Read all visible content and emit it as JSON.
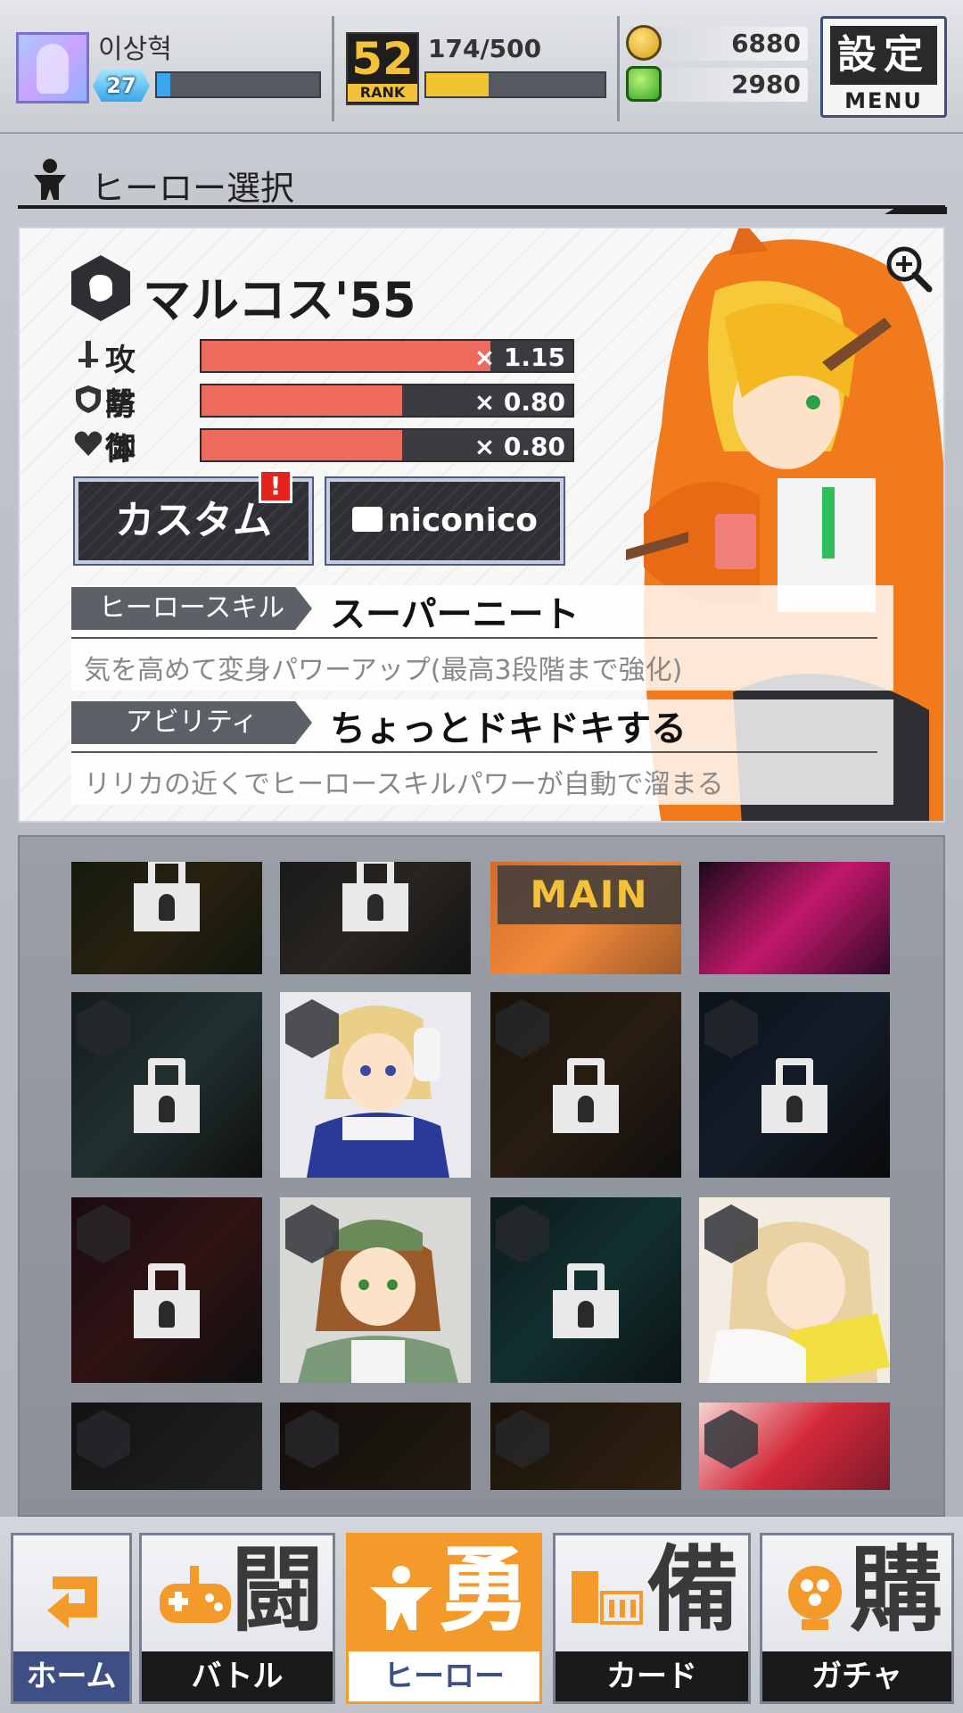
{
  "player": {
    "name": "이상혁",
    "level": "27",
    "xp_fraction": 0.08,
    "rank": "52",
    "rank_label": "RANK",
    "stamina": "174/500",
    "stamina_fraction": 0.35
  },
  "currency": {
    "coins": "6880",
    "gems": "2980"
  },
  "menu": {
    "kanji": "設定",
    "label": "MENU"
  },
  "section": {
    "title": "ヒーロー選択"
  },
  "hero": {
    "name": "マルコス'55",
    "stats": [
      {
        "label": "攻撃",
        "multiplier": "× 1.15",
        "fraction": 0.78
      },
      {
        "label": "防御",
        "multiplier": "× 0.80",
        "fraction": 0.54
      },
      {
        "label": "体力",
        "multiplier": "× 0.80",
        "fraction": 0.54
      }
    ],
    "custom_button": "カスタム",
    "alert_badge": "!",
    "niconico_button": "niconico",
    "skill_tag": "ヒーロースキル",
    "skill_name": "スーパーニート",
    "skill_desc": "気を高めて変身パワーアップ(最高3段階まで強化)",
    "ability_tag": "アビリティ",
    "ability_name": "ちょっとドキドキする",
    "ability_desc": "リリカの近くでヒーロースキルパワーが自動で溜まる"
  },
  "grid": {
    "main_label": "MAIN"
  },
  "nav": {
    "home": "ホーム",
    "battle": "バトル",
    "battle_kanji": "闘",
    "hero": "ヒーロー",
    "hero_kanji": "勇",
    "card": "カード",
    "card_kanji": "備",
    "gacha": "ガチャ",
    "gacha_kanji": "購"
  },
  "colors": {
    "accent_orange": "#f39a2a",
    "stat_red": "#ee6a5c",
    "stamina_yellow": "#f2c530",
    "xp_blue": "#3aa6f0",
    "nav_blue": "#3e4f86"
  }
}
